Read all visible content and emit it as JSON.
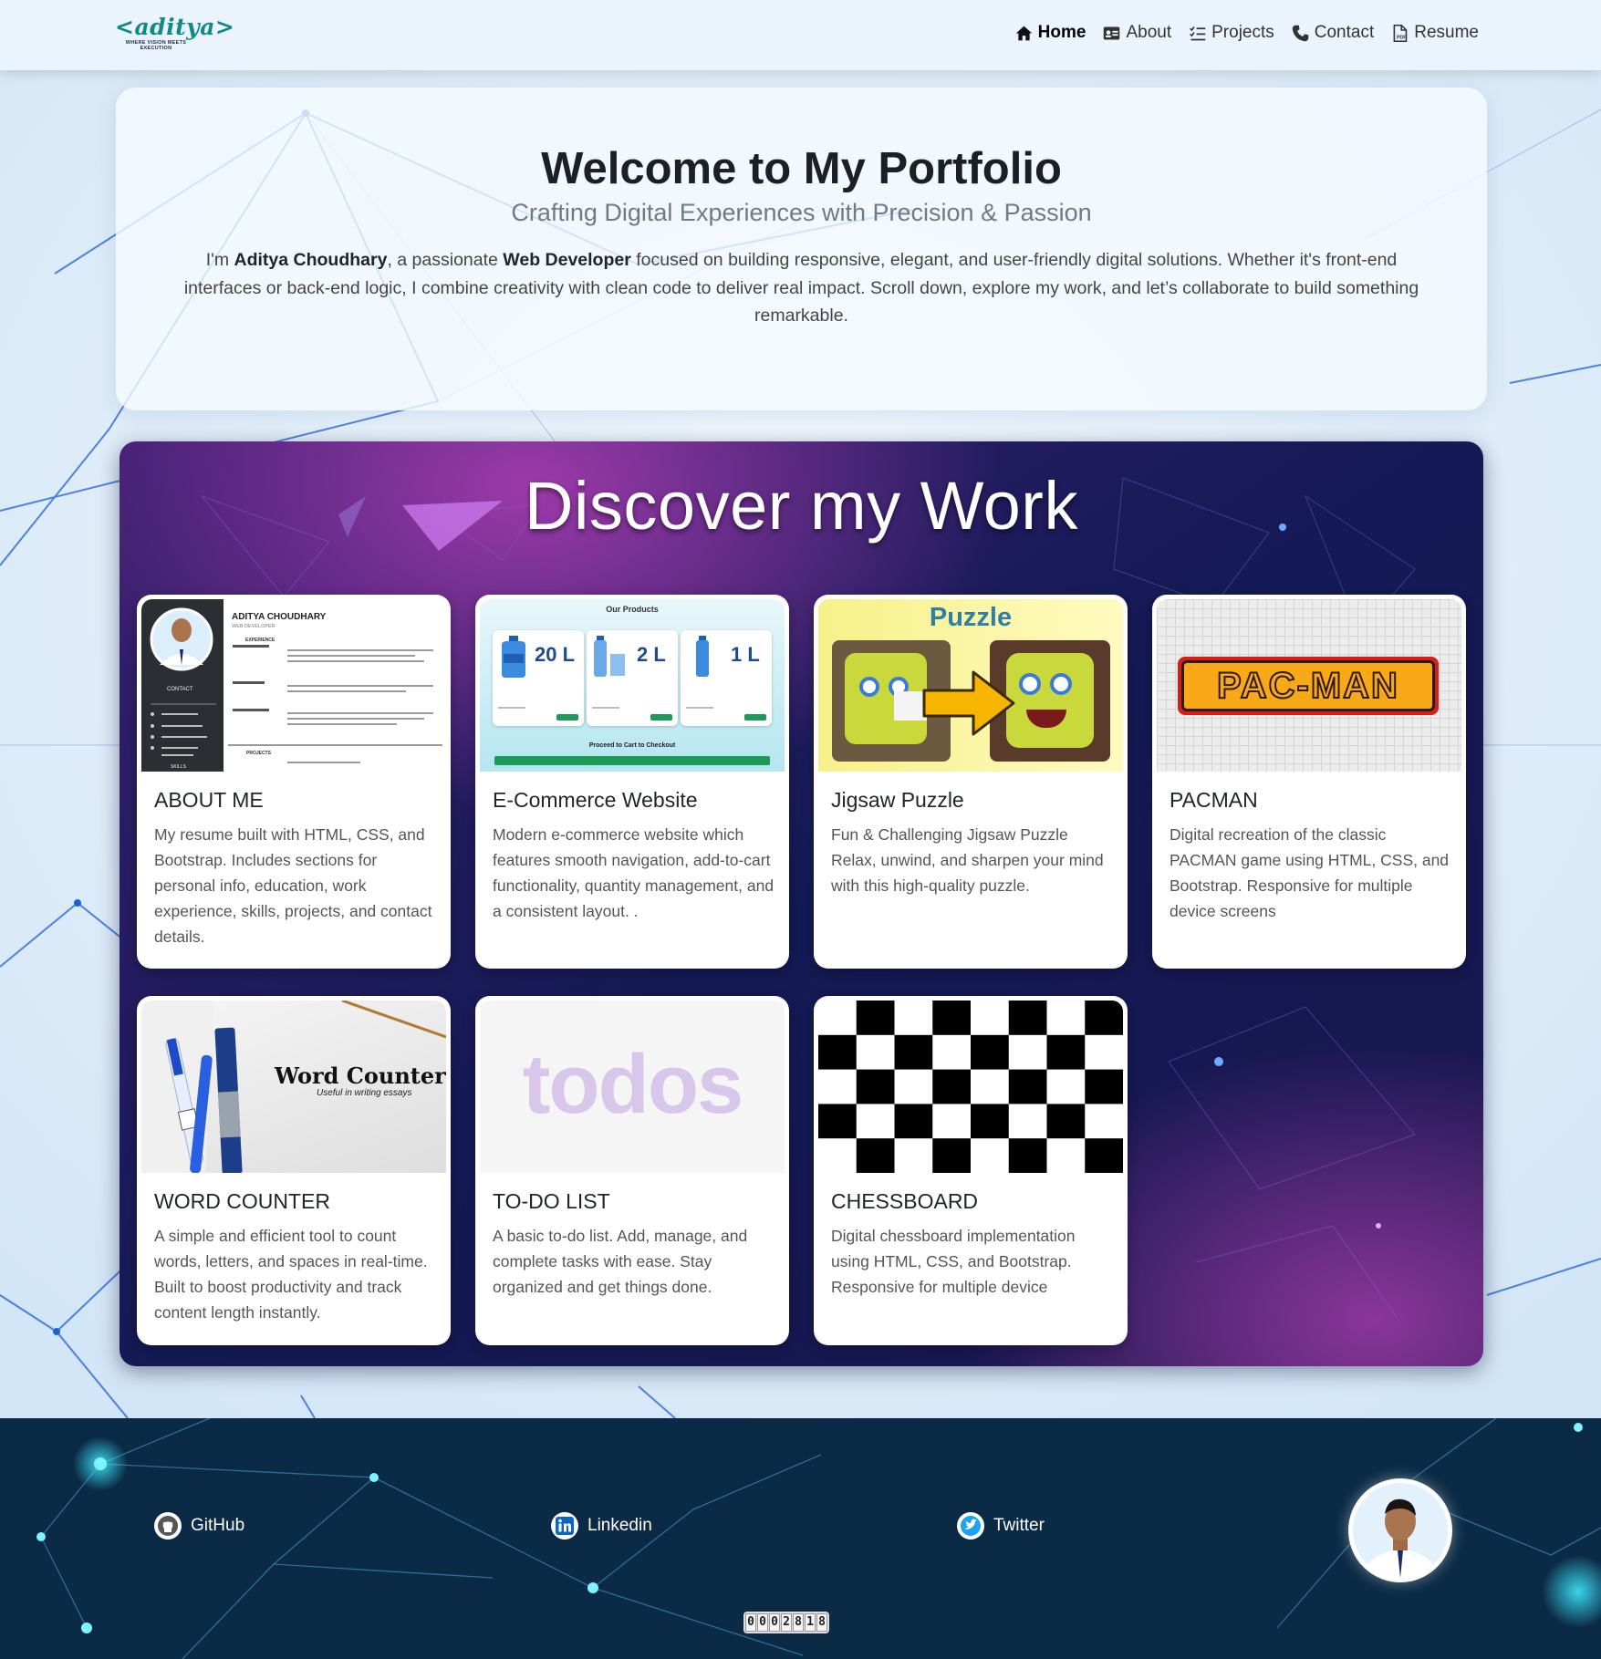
{
  "brand": {
    "logo_text": "<aditya>",
    "tagline": "WHERE VISION MEETS EXECUTION"
  },
  "nav": {
    "items": [
      {
        "label": "Home",
        "icon": "home-icon"
      },
      {
        "label": "About",
        "icon": "id-card-icon"
      },
      {
        "label": "Projects",
        "icon": "list-check-icon"
      },
      {
        "label": "Contact",
        "icon": "phone-icon"
      },
      {
        "label": "Resume",
        "icon": "pdf-file-icon"
      }
    ]
  },
  "hero": {
    "title": "Welcome to My Portfolio",
    "subtitle": "Crafting Digital Experiences with Precision & Passion",
    "intro_1": "I'm ",
    "name": "Aditya Choudhary",
    "intro_2": ", a passionate ",
    "role": "Web Developer",
    "intro_3": " focused on building responsive, elegant, and user-friendly digital solutions. Whether it's front-end interfaces or back-end logic, I combine creativity with clean code to deliver real impact. Scroll down, explore my work, and let’s collaborate to build something remarkable."
  },
  "work": {
    "title": "Discover my Work",
    "projects": [
      {
        "title": "ABOUT ME",
        "desc": "My resume built with HTML, CSS, and Bootstrap. Includes sections for personal info, education, work experience, skills, projects, and contact details."
      },
      {
        "title": "E-Commerce Website",
        "desc": "Modern e-commerce website which features smooth navigation, add-to-cart functionality, quantity management, and a consistent layout. ."
      },
      {
        "title": "Jigsaw Puzzle",
        "desc": "Fun & Challenging Jigsaw Puzzle Relax, unwind, and sharpen your mind with this high-quality puzzle."
      },
      {
        "title": "PACMAN",
        "desc": "Digital recreation of the classic PACMAN game using HTML, CSS, and Bootstrap. Responsive for multiple device screens"
      },
      {
        "title": "WORD COUNTER",
        "desc": "A simple and efficient tool to count words, letters, and spaces in real-time. Built to boost productivity and track content length instantly."
      },
      {
        "title": "TO-DO LIST",
        "desc": "A basic to-do list. Add, manage, and complete tasks with ease. Stay organized and get things done."
      },
      {
        "title": "CHESSBOARD",
        "desc": "Digital chessboard implementation using HTML, CSS, and Bootstrap. Responsive for multiple device"
      }
    ],
    "thumbs": {
      "resume_name": "ADITYA CHOUDHARY",
      "resume_role": "WEB DEVELOPER",
      "resume_contact": "CONTACT",
      "resume_experience": "EXPERIENCE",
      "resume_projects": "PROJECTS",
      "resume_skills": "SKILLS",
      "shop_heading": "Our Products",
      "shop_sizes": [
        "20 L",
        "2 L",
        "1 L"
      ],
      "shop_cta": "Proceed to Cart to Checkout",
      "puzzle_heading": "Puzzle",
      "pacman_logo": "PAC-MAN",
      "wc_title": "Word Counter",
      "wc_subtitle": "Useful in writing essays",
      "todo_logo": "todos"
    }
  },
  "footer": {
    "links": [
      {
        "label": "GitHub",
        "icon": "github-icon"
      },
      {
        "label": "Linkedin",
        "icon": "linkedin-icon"
      },
      {
        "label": "Twitter",
        "icon": "twitter-icon"
      }
    ],
    "visit_counter": "0002818"
  },
  "colors": {
    "accent": "#0f8a88",
    "work_bg": "#141a55",
    "footer_bg": "#0b2a45"
  }
}
